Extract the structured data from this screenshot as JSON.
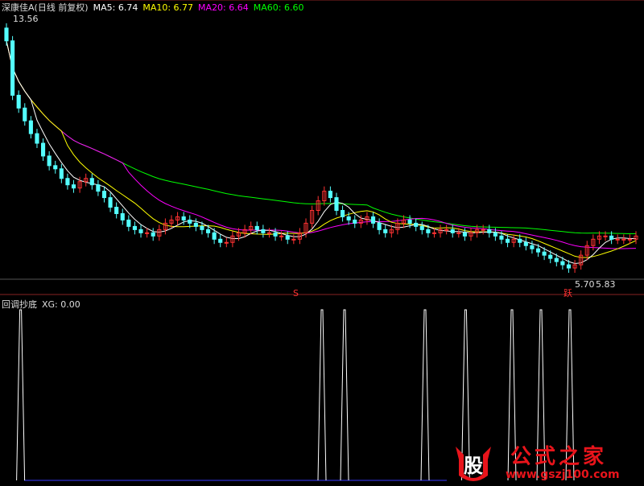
{
  "header": {
    "title": "深康佳A(日线 前复权)",
    "ma5_label": "MA5: 6.74",
    "ma10_label": "MA10: 6.77",
    "ma20_label": "MA20: 6.64",
    "ma60_label": "MA60: 6.60"
  },
  "sub_header": {
    "indicator_name": "回调抄底",
    "xg_label": "XG: 0.00"
  },
  "annotations": {
    "high_price": "13.56",
    "low_price": "5.70",
    "low_price2": "5.83",
    "sell_marker": "S",
    "buy_marker": "跃"
  },
  "watermark": {
    "logo_char": "股",
    "site_name": "公式之家",
    "url": "www.gszj100.com"
  },
  "colors": {
    "background": "#000000",
    "up_candle": "#ff3232",
    "down_candle": "#54ffff",
    "ma5": "#ffffff",
    "ma10": "#ffff00",
    "ma20": "#ff00ff",
    "ma60": "#00ff00",
    "xg_line": "#ffffff",
    "grid": "#882222",
    "accent_red": "#e8141b"
  },
  "chart_data": [
    {
      "type": "candlestick",
      "title": "深康佳A(日线 前复权)",
      "ylim": [
        5.5,
        13.8
      ],
      "annotations": {
        "max": 13.56,
        "min": 5.7,
        "near_last": 5.83
      },
      "series": [
        {
          "name": "MA5",
          "last": 6.74
        },
        {
          "name": "MA10",
          "last": 6.77
        },
        {
          "name": "MA20",
          "last": 6.64
        },
        {
          "name": "MA60",
          "last": 6.6
        }
      ],
      "closes": [
        12.9,
        11.2,
        10.8,
        10.4,
        10.0,
        9.7,
        9.3,
        9.0,
        8.9,
        8.6,
        8.4,
        8.3,
        8.5,
        8.6,
        8.4,
        8.2,
        8.0,
        7.7,
        7.5,
        7.3,
        7.1,
        7.0,
        6.9,
        6.9,
        6.8,
        7.0,
        7.2,
        7.3,
        7.4,
        7.3,
        7.2,
        7.1,
        7.0,
        6.9,
        6.7,
        6.6,
        6.6,
        6.8,
        6.9,
        7.0,
        7.1,
        7.0,
        6.9,
        6.9,
        6.8,
        6.8,
        6.7,
        6.7,
        6.9,
        7.2,
        7.6,
        7.9,
        8.2,
        8.0,
        7.6,
        7.4,
        7.3,
        7.2,
        7.3,
        7.4,
        7.2,
        7.0,
        6.9,
        7.0,
        7.2,
        7.3,
        7.2,
        7.1,
        7.0,
        6.9,
        6.9,
        7.0,
        7.0,
        6.9,
        6.9,
        6.8,
        6.9,
        7.0,
        7.0,
        6.9,
        6.8,
        6.7,
        6.6,
        6.7,
        6.6,
        6.5,
        6.4,
        6.3,
        6.2,
        6.1,
        6.0,
        5.9,
        5.8,
        5.9,
        6.2,
        6.5,
        6.7,
        6.8,
        6.8,
        6.7,
        6.7,
        6.7,
        6.7,
        6.8
      ]
    },
    {
      "type": "line",
      "name": "XG",
      "last": 0.0,
      "signal_x_fraction": [
        0.032,
        0.5,
        0.535,
        0.66,
        0.723,
        0.795,
        0.84,
        0.885
      ]
    }
  ]
}
